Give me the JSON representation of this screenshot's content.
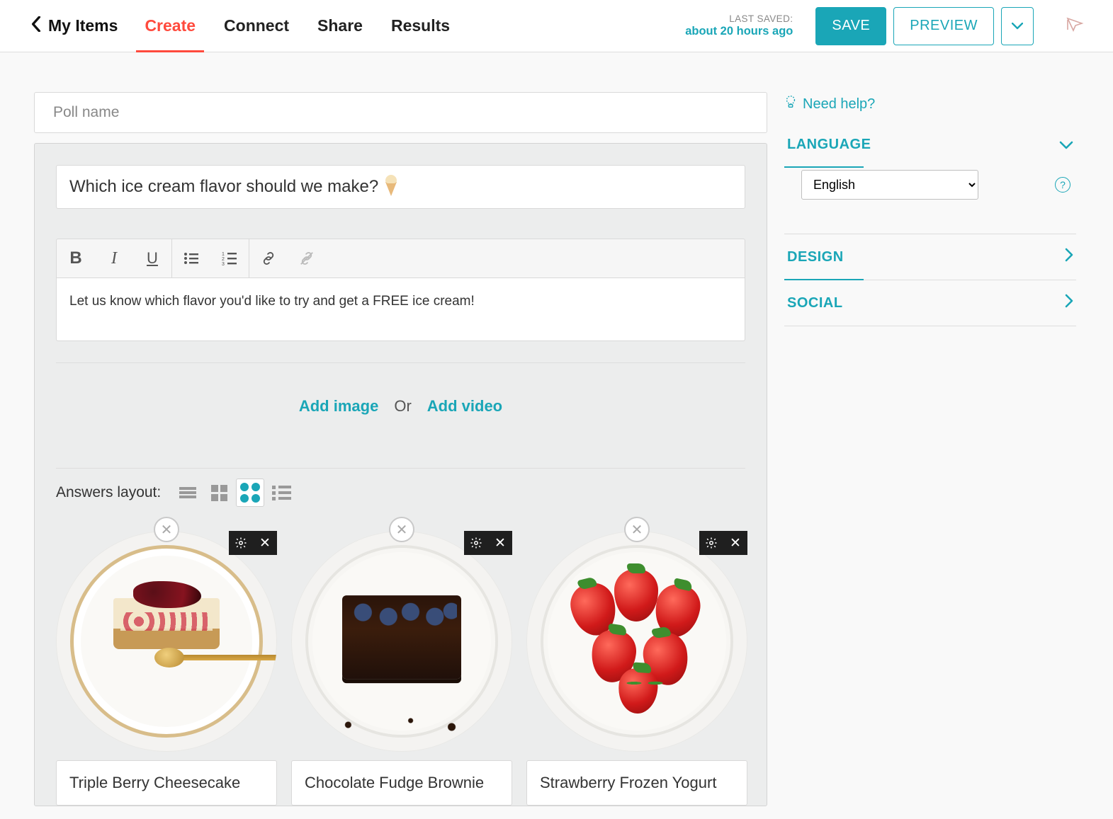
{
  "topnav": {
    "my_items": "My Items",
    "create": "Create",
    "connect": "Connect",
    "share": "Share",
    "results": "Results"
  },
  "last_saved": {
    "label": "LAST SAVED:",
    "time": "about 20 hours ago"
  },
  "buttons": {
    "save": "SAVE",
    "preview": "PREVIEW"
  },
  "poll": {
    "name_placeholder": "Poll name",
    "name_value": "",
    "question": "Which ice cream flavor should we make?",
    "description": "Let us know which flavor you'd like to try and get a FREE ice cream!"
  },
  "media": {
    "add_image": "Add image",
    "or": "Or",
    "add_video": "Add video"
  },
  "layout": {
    "label": "Answers layout:",
    "selected": "image-grid-round"
  },
  "answers": [
    {
      "label": "Triple Berry Cheesecake"
    },
    {
      "label": "Chocolate Fudge Brownie"
    },
    {
      "label": "Strawberry Frozen Yogurt"
    }
  ],
  "sidebar": {
    "need_help": "Need help?",
    "sections": {
      "language": "LANGUAGE",
      "design": "DESIGN",
      "social": "SOCIAL"
    },
    "language_selected": "English",
    "language_options": [
      "English"
    ]
  },
  "colors": {
    "accent": "#1aa6b7",
    "active_tab": "#ff4a3d"
  }
}
